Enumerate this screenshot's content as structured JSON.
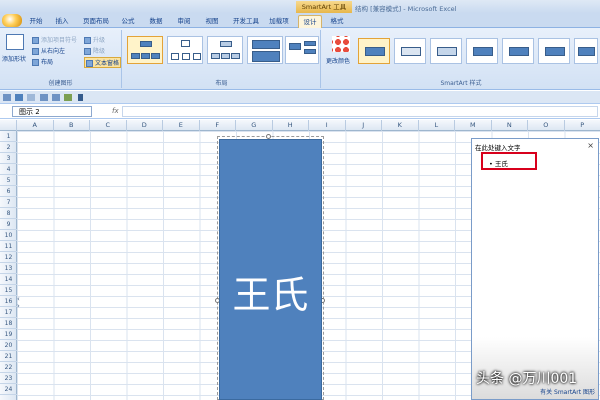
{
  "window": {
    "title": "结构 [兼容模式] - Microsoft Excel",
    "context_tool": "SmartArt 工具"
  },
  "tabs": [
    "开始",
    "插入",
    "页面布局",
    "公式",
    "数据",
    "审阅",
    "视图",
    "开发工具",
    "加载项",
    "设计",
    "格式"
  ],
  "active_tab": "设计",
  "ribbon": {
    "create_group": {
      "label": "创建图形",
      "add_shape": "添加形状",
      "add_bullet": "添加项目符号",
      "right_to_left": "从右向左",
      "layout": "布局",
      "promote": "升级",
      "demote": "降级",
      "text_pane": "文本窗格"
    },
    "layouts_group": {
      "label": "布局"
    },
    "styles_group": {
      "label": "SmartArt 样式",
      "change_colors": "更改颜色"
    }
  },
  "name_box": "图示 2",
  "fx": "fx",
  "columns": [
    "A",
    "B",
    "C",
    "D",
    "E",
    "F",
    "G",
    "H",
    "I",
    "J",
    "K",
    "L",
    "M",
    "N",
    "O",
    "P"
  ],
  "rows": [
    "1",
    "2",
    "3",
    "4",
    "5",
    "6",
    "7",
    "8",
    "9",
    "10",
    "11",
    "12",
    "13",
    "14",
    "15",
    "16",
    "17",
    "18",
    "19",
    "20",
    "21",
    "22",
    "23",
    "24"
  ],
  "smartart": {
    "text": "王氏",
    "fill": "#4f81bd"
  },
  "text_pane": {
    "title": "在此处键入文字",
    "close": "×",
    "items": [
      "王氏"
    ],
    "link": "有关 SmartArt 图形"
  },
  "watermark": "头条 @万川001"
}
